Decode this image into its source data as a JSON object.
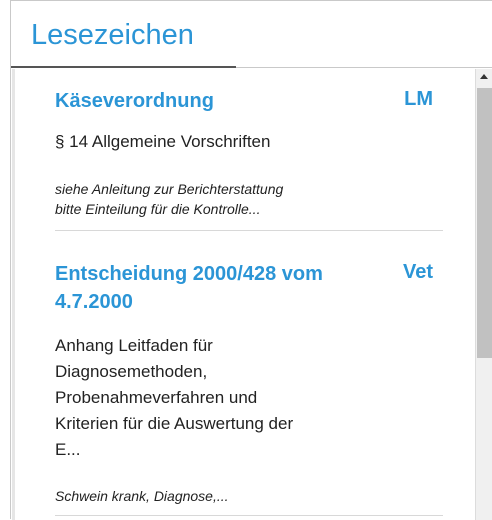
{
  "header": {
    "title": "Lesezeichen"
  },
  "bookmarks": [
    {
      "title": "Käseverordnung",
      "tag": "LM",
      "description_lines": [
        "§ 14 Allgemeine Vorschriften"
      ],
      "note_lines": [
        "siehe Anleitung zur Berichterstattung",
        "bitte Einteilung für die Kontrolle..."
      ]
    },
    {
      "title_lines": [
        "Entscheidung 2000/428 vom",
        "4.7.2000"
      ],
      "tag": "Vet",
      "description_lines": [
        "Anhang Leitfaden für",
        "Diagnosemethoden,",
        "Probenahmeverfahren und",
        "Kriterien für die Auswertung der",
        "E..."
      ],
      "note_lines": [
        "Schwein krank, Diagnose,..."
      ]
    }
  ],
  "colors": {
    "accent": "#2b95d6",
    "text": "#222222",
    "divider": "#d8d8d8"
  },
  "icons": {
    "scroll_up": "triangle-up-icon"
  }
}
